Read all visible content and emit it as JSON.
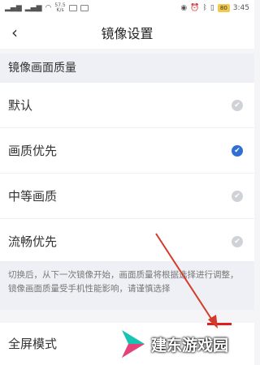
{
  "status_bar": {
    "speed_top": "57.5",
    "speed_bottom": "K/s",
    "battery": "80",
    "time": "3:45"
  },
  "header": {
    "title": "镜像设置"
  },
  "section": {
    "quality_title": "镜像画面质量"
  },
  "options": [
    {
      "label": "默认",
      "selected": false
    },
    {
      "label": "画质优先",
      "selected": true
    },
    {
      "label": "中等画质",
      "selected": false
    },
    {
      "label": "流畅优先",
      "selected": false
    }
  ],
  "note": {
    "text": "切换后，从下一次镜像开始，画面质量将根据选择进行调整，镜像画面质量受手机性能影响，请谨慎选择"
  },
  "fullscreen": {
    "label": "全屏模式"
  },
  "colors": {
    "accent": "#2f6fd6",
    "check_off": "#cfd2d6",
    "arrow": "#d43b2a"
  }
}
